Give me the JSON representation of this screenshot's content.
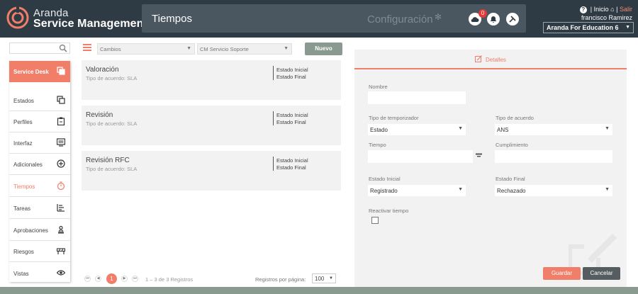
{
  "header": {
    "brand_line1": "Aranda",
    "brand_line2": "Service Management",
    "page_title": "Tiempos",
    "config_label": "Configuración",
    "notification_count": "0",
    "help_icon": "?",
    "inicio": "Inicio",
    "salir": "Salir",
    "separator": "|",
    "user": "francisco Ramirez",
    "company": "Aranda For Education 6"
  },
  "sidebar": {
    "search_placeholder": "",
    "items": [
      {
        "label": "Service Desk",
        "icon": "copy-icon"
      },
      {
        "label": "Estados",
        "icon": "copy-icon"
      },
      {
        "label": "Perfiles",
        "icon": "clipboard-icon"
      },
      {
        "label": "Interfaz",
        "icon": "monitor-icon"
      },
      {
        "label": "Adicionales",
        "icon": "plus-circle-icon"
      },
      {
        "label": "Tiempos",
        "icon": "stopwatch-icon"
      },
      {
        "label": "Tareas",
        "icon": "task-list-icon"
      },
      {
        "label": "Aprobaciones",
        "icon": "stamp-icon"
      },
      {
        "label": "Riesgos",
        "icon": "barrier-icon"
      },
      {
        "label": "Vistas",
        "icon": "eye-icon"
      }
    ]
  },
  "filters": {
    "module": "Cambios",
    "service": "CM Servicio Soporte",
    "new_button": "Nuevo"
  },
  "cards": [
    {
      "name": "Valoración",
      "type": "Tipo de acuerdo: SLA",
      "state_initial": "Estado Inicial",
      "state_final": "Estado Final"
    },
    {
      "name": "Revisión",
      "type": "Tipo de acuerdo: SLA",
      "state_initial": "Estado Inicial",
      "state_final": "Estado Final"
    },
    {
      "name": "Revisión RFC",
      "type": "Tipo de acuerdo: SLA",
      "state_initial": "Estado Inicial",
      "state_final": "Estado Final"
    }
  ],
  "pagination": {
    "current_page": "1",
    "summary": "1 – 3 de 3 Registros",
    "per_page_label": "Registros por página:",
    "per_page_value": "100"
  },
  "detail": {
    "tab_label": "Detalles",
    "nombre_label": "Nombre",
    "nombre_value": "",
    "timer_type_label": "Tipo de temporizador",
    "timer_type_value": "Estado",
    "agreement_type_label": "Tipo de acuerdo",
    "agreement_type_value": "ANS",
    "tiempo_label": "Tiempo",
    "tiempo_value": "",
    "cumplimiento_label": "Cumplimiento",
    "cumplimiento_value": "",
    "initial_state_label": "Estado Inicial",
    "initial_state_value": "Registrado",
    "final_state_label": "Estado Final",
    "final_state_value": "Rechazado",
    "reactivate_label": "Reactivar tiempo",
    "reactivate_checked": false,
    "save_button": "Guardar",
    "cancel_button": "Cancelar"
  },
  "colors": {
    "accent": "#f07e69",
    "header_bg": "#2e3b44",
    "new_button": "#8a9a91",
    "cancel_button": "#555d61"
  }
}
